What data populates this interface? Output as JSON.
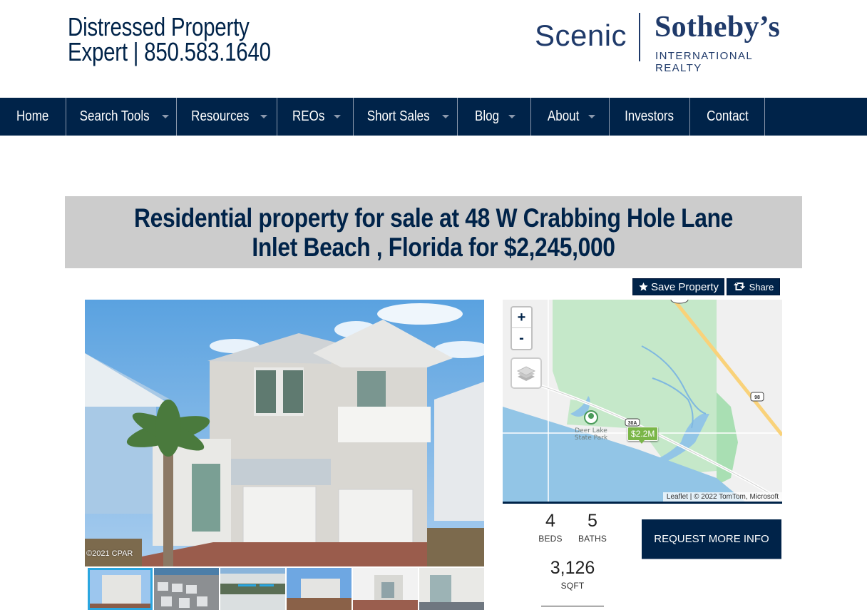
{
  "header": {
    "site_title": "Distressed Property Expert | 850.583.1640",
    "logo": {
      "scenic": "Scenic",
      "brand": "Sotheby’s",
      "tagline": "INTERNATIONAL REALTY"
    }
  },
  "nav": {
    "items": [
      {
        "label": "Home",
        "dropdown": false
      },
      {
        "label": "Search Tools",
        "dropdown": true
      },
      {
        "label": "Resources",
        "dropdown": true
      },
      {
        "label": "REOs",
        "dropdown": true
      },
      {
        "label": "Short Sales",
        "dropdown": true
      },
      {
        "label": "Blog",
        "dropdown": true
      },
      {
        "label": "About",
        "dropdown": true
      },
      {
        "label": "Investors",
        "dropdown": false
      },
      {
        "label": "Contact",
        "dropdown": false
      }
    ]
  },
  "listing": {
    "title": "Residential property for sale at 48 W Crabbing Hole Lane Inlet Beach , Florida for $2,245,000",
    "actions": {
      "save_label": "Save Property",
      "share_label": "Share"
    },
    "photo": {
      "copyright": "©2021 CPAR",
      "thumbnail_count": 6,
      "active_thumbnail": 0
    },
    "map": {
      "zoom_in": "+",
      "zoom_out": "-",
      "marker_label": "$2.2M",
      "park_label": "Deer Lake State Park",
      "road_labels": [
        "30A",
        "98"
      ],
      "attribution_link": "Leaflet",
      "attribution_text": " | © 2022 TomTom, Microsoft"
    },
    "stats": {
      "beds": {
        "value": "4",
        "label": "BEDS"
      },
      "baths": {
        "value": "5",
        "label": "BATHS"
      },
      "sqft": {
        "value": "3,126",
        "label": "SQFT"
      }
    },
    "request_label": "REQUEST MORE INFO"
  },
  "colors": {
    "brand_navy": "#002349",
    "title_box_bg": "#cccccc",
    "marker_green": "#7ab648",
    "thumb_active": "#2aa6e0"
  }
}
